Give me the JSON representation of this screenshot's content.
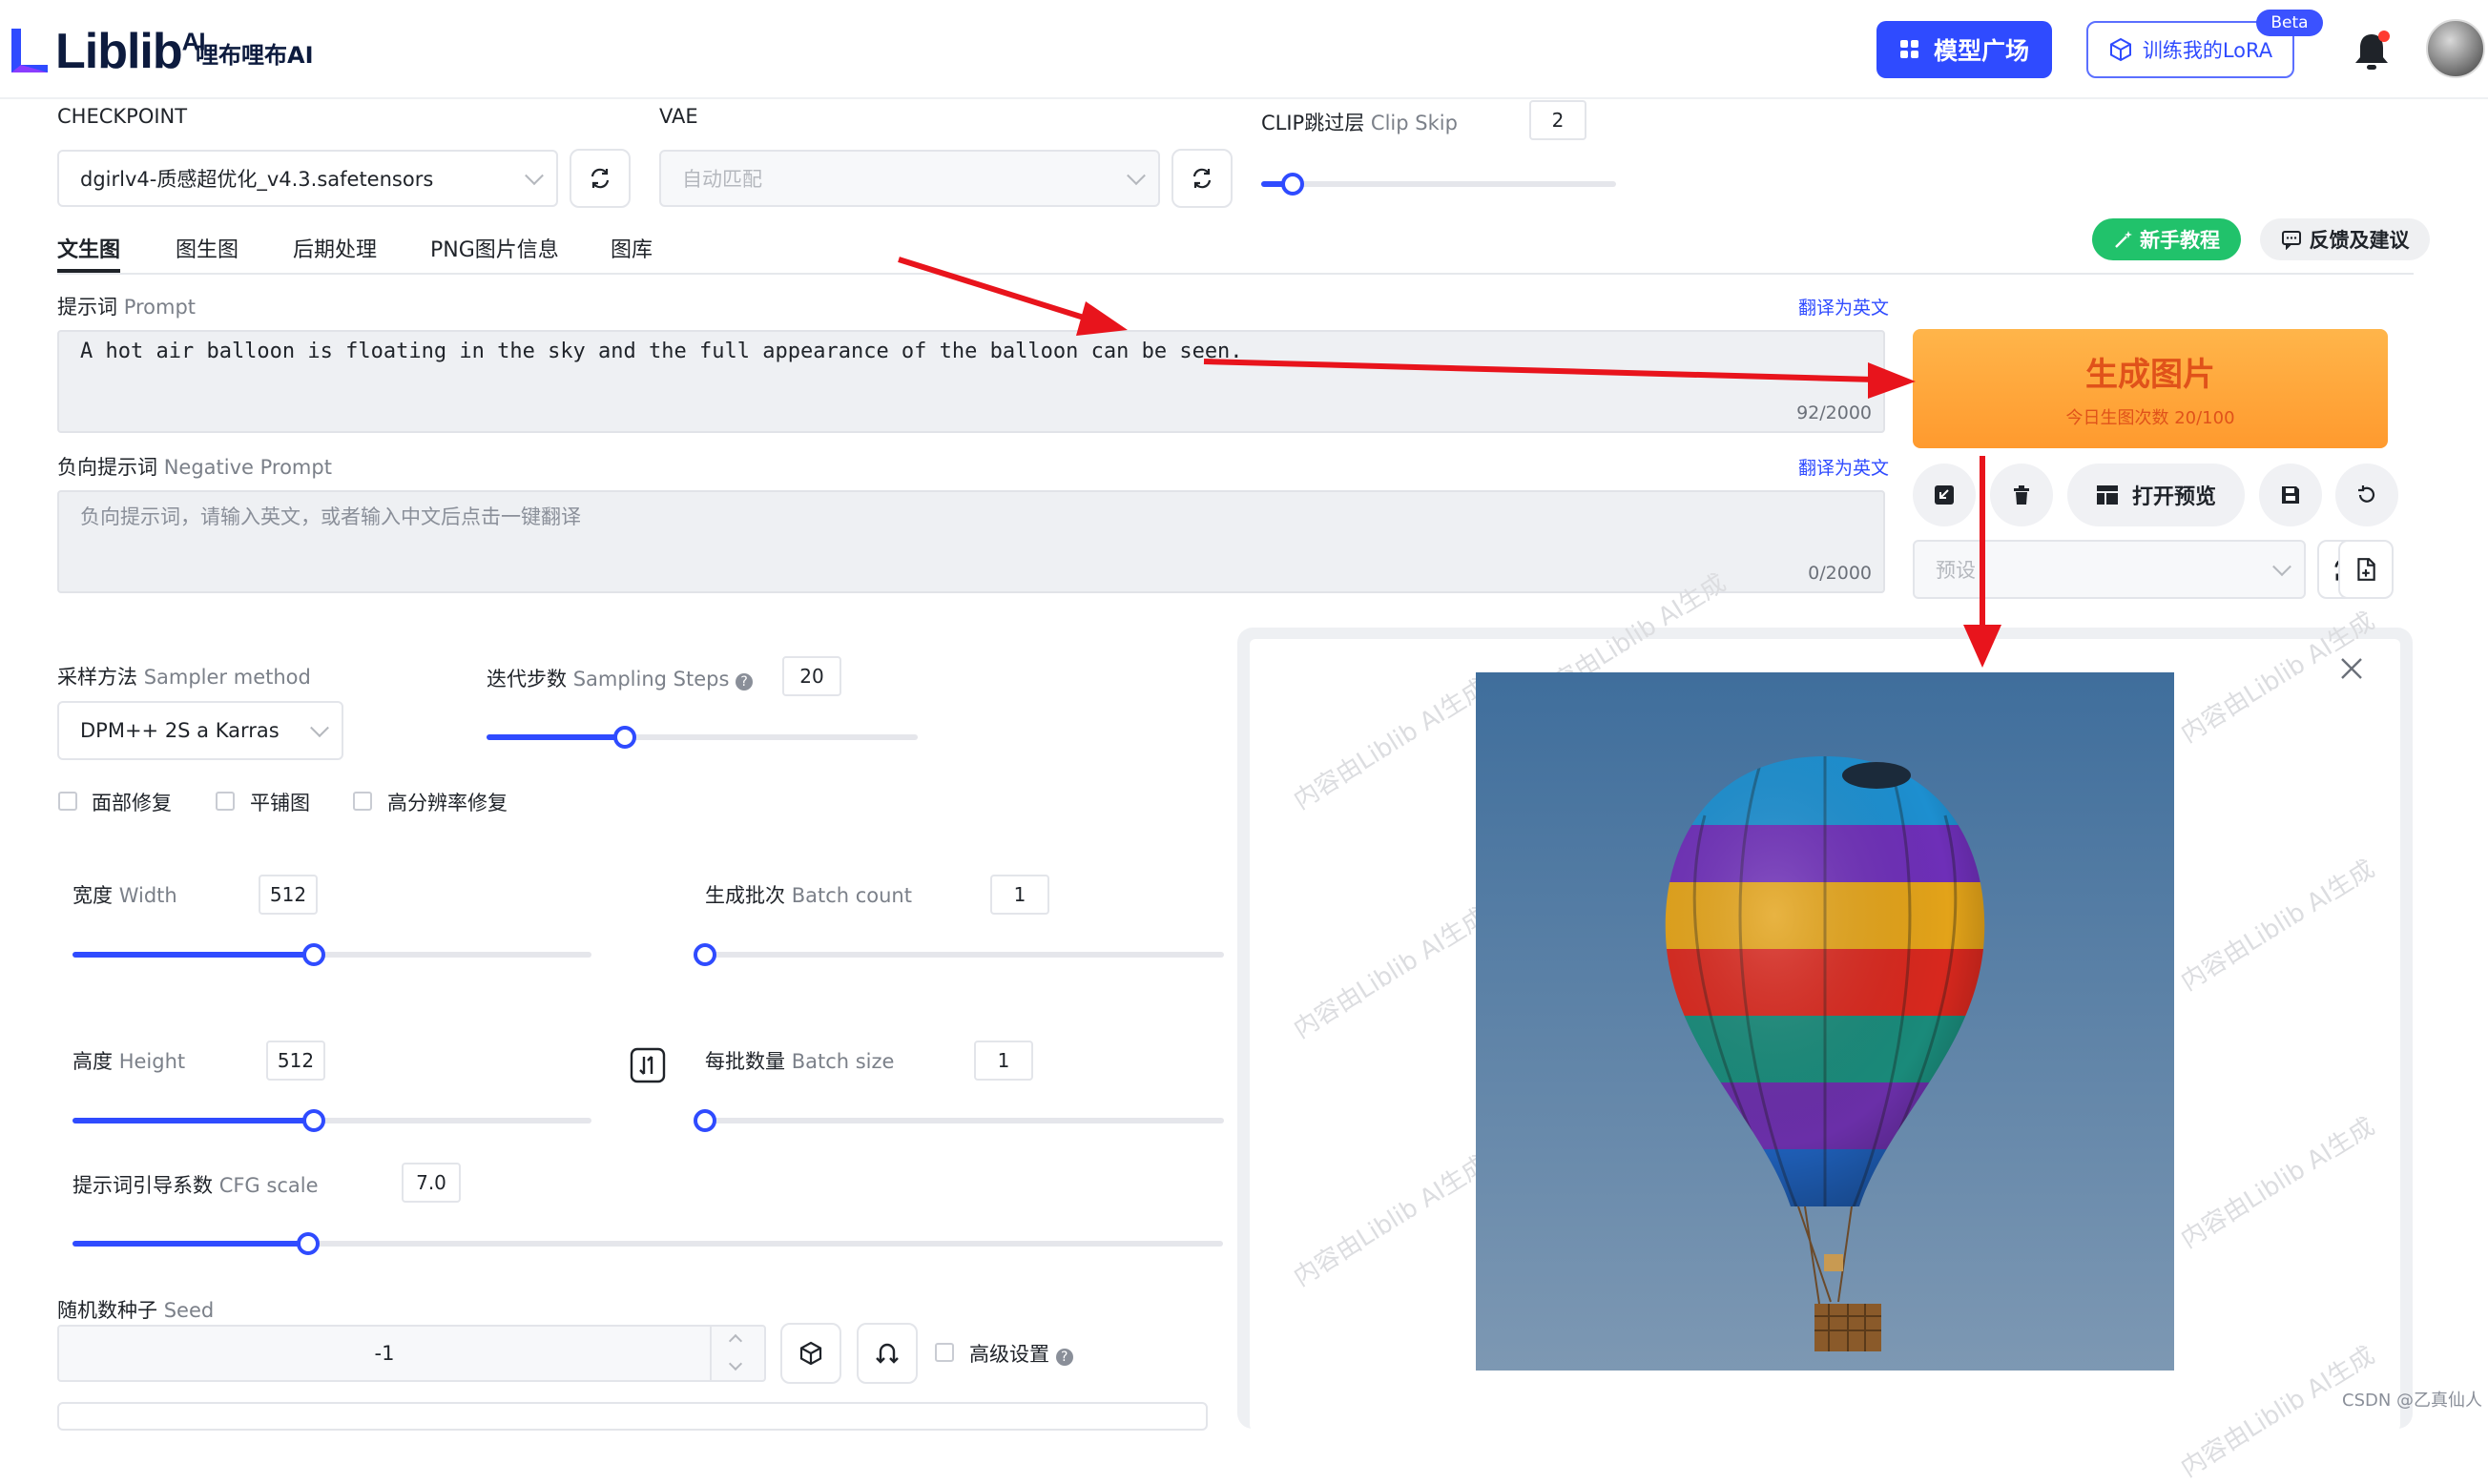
{
  "header": {
    "logo_text": "Liblib",
    "logo_ai": "AI",
    "logo_sub": "哩布哩布AI",
    "model_square_label": "模型广场",
    "train_lora_label": "训练我的LoRA",
    "beta_badge": "Beta"
  },
  "settings": {
    "checkpoint_label": "CHECKPOINT",
    "checkpoint_value": "dgirlv4-质感超优化_v4.3.safetensors",
    "vae_label": "VAE",
    "vae_value": "自动匹配",
    "clip_label": "CLIP跳过层",
    "clip_label_en": "Clip Skip",
    "clip_value": "2",
    "clip_fraction": 0.09
  },
  "tabs": [
    "文生图",
    "图生图",
    "后期处理",
    "PNG图片信息",
    "图库"
  ],
  "actions": {
    "tutorial_label": "新手教程",
    "feedback_label": "反馈及建议"
  },
  "prompt": {
    "label": "提示词",
    "label_en": "Prompt",
    "translate": "翻译为英文",
    "value": "A hot air balloon is floating in the sky and the full appearance of the balloon can be seen.",
    "counter": "92/2000"
  },
  "negative_prompt": {
    "label": "负向提示词",
    "label_en": "Negative Prompt",
    "translate": "翻译为英文",
    "placeholder": "负向提示词，请输入英文，或者输入中文后点击一键翻译",
    "counter": "0/2000"
  },
  "generate": {
    "title": "生成图片",
    "subtitle": "今日生图次数 20/100",
    "open_preview": "打开预览",
    "preset_placeholder": "预设"
  },
  "sampler": {
    "label": "采样方法",
    "label_en": "Sampler method",
    "value": "DPM++ 2S a Karras"
  },
  "steps": {
    "label": "迭代步数",
    "label_en": "Sampling Steps",
    "value": "20",
    "fraction": 0.32
  },
  "checkboxes": [
    "面部修复",
    "平铺图",
    "高分辨率修复"
  ],
  "width": {
    "label": "宽度",
    "label_en": "Width",
    "value": "512",
    "fraction": 0.465
  },
  "height": {
    "label": "高度",
    "label_en": "Height",
    "value": "512",
    "fraction": 0.465
  },
  "batch_count": {
    "label": "生成批次",
    "label_en": "Batch count",
    "value": "1",
    "fraction": 0.0
  },
  "batch_size": {
    "label": "每批数量",
    "label_en": "Batch size",
    "value": "1",
    "fraction": 0.0
  },
  "cfg": {
    "label": "提示词引导系数",
    "label_en": "CFG scale",
    "value": "7.0",
    "fraction": 0.205
  },
  "seed": {
    "label": "随机数种子",
    "label_en": "Seed",
    "value": "-1",
    "advanced_label": "高级设置"
  },
  "watermark_text": "内容由Liblib AI生成",
  "footer_mark": "CSDN @乙真仙人",
  "colors": {
    "primary": "#2f4bff",
    "generate": "#ff9a2e",
    "green": "#21c26b",
    "arrow": "#e8141c"
  }
}
